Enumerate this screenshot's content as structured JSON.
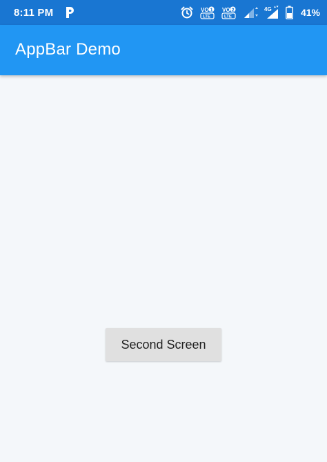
{
  "status_bar": {
    "time": "8:11 PM",
    "battery_percent": "41%",
    "sim1_label": "VO",
    "sim1_sub": "LTE",
    "sim1_num": "1",
    "sim2_label": "VO",
    "sim2_sub": "LTE",
    "sim2_num": "2",
    "network_type": "4G",
    "icons": [
      "p-notification-icon",
      "alarm-icon",
      "volte-sim1-icon",
      "volte-sim2-icon",
      "signal-sim1-icon",
      "signal-sim2-icon",
      "battery-icon"
    ]
  },
  "app_bar": {
    "title": "AppBar Demo"
  },
  "main": {
    "button_label": "Second Screen"
  },
  "colors": {
    "status_bar": "#1976d2",
    "app_bar": "#2196f3",
    "background": "#f4f7fa",
    "button": "#e0e0e0"
  }
}
